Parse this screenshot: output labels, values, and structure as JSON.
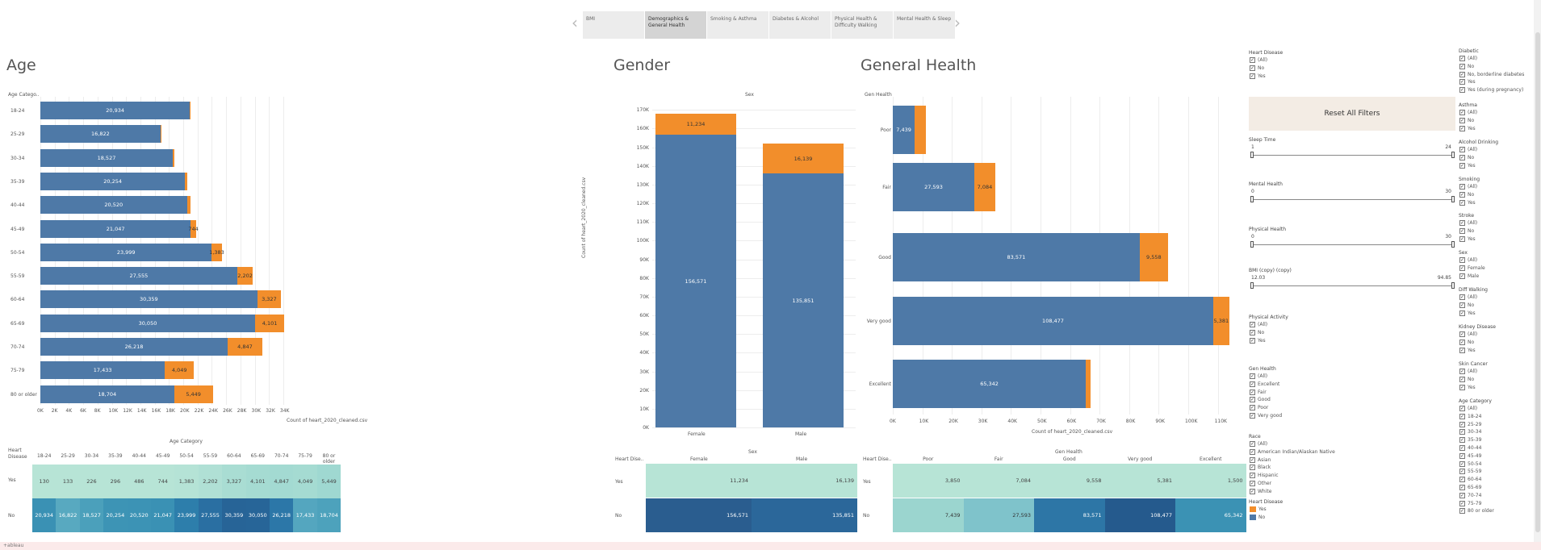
{
  "tabs": [
    "BMI",
    "Demographics & General Health",
    "Smoking & Asthma",
    "Diabetes & Alcohol",
    "Physical Health & Difficulty Walking",
    "Mental Health & Sleep"
  ],
  "active_tab": 1,
  "nav": {
    "prev": "‹",
    "next": "›"
  },
  "colors": {
    "no": "#4e79a7",
    "yes": "#f28e2b",
    "accent": "#f3ece4"
  },
  "age": {
    "title": "Age",
    "axis_title": "Age Catego..",
    "xlabel": "Count of heart_2020_cleaned.csv",
    "ticks": [
      "0K",
      "2K",
      "4K",
      "6K",
      "8K",
      "10K",
      "12K",
      "14K",
      "16K",
      "18K",
      "20K",
      "22K",
      "24K",
      "26K",
      "28K",
      "30K",
      "32K",
      "34K"
    ],
    "categories": [
      "18-24",
      "25-29",
      "30-34",
      "35-39",
      "40-44",
      "45-49",
      "50-54",
      "55-59",
      "60-64",
      "65-69",
      "70-74",
      "75-79",
      "80 or older"
    ],
    "no": [
      20934,
      16822,
      18527,
      20254,
      20520,
      21047,
      23999,
      27555,
      30359,
      30050,
      26218,
      17433,
      18704
    ],
    "yes": [
      130,
      133,
      226,
      296,
      486,
      744,
      1383,
      2202,
      3327,
      4101,
      4847,
      4049,
      5449
    ],
    "no_labels": [
      "20,934",
      "16,822",
      "18,527",
      "20,254",
      "20,520",
      "21,047",
      "23,999",
      "27,555",
      "30,359",
      "30,050",
      "26,218",
      "17,433",
      "18,704"
    ],
    "yes_labels": [
      "",
      "",
      "",
      "",
      "",
      "744",
      "1,383",
      "2,202",
      "3,327",
      "4,101",
      "4,847",
      "4,049",
      "5,449"
    ],
    "table_title": "Age Category",
    "table_row_header": "Heart Disease",
    "table_yes": [
      "130",
      "133",
      "226",
      "296",
      "486",
      "744",
      "1,383",
      "2,202",
      "3,327",
      "4,101",
      "4,847",
      "4,049",
      "5,449"
    ],
    "table_no": [
      "20,934",
      "16,822",
      "18,527",
      "20,254",
      "20,520",
      "21,047",
      "23,999",
      "27,555",
      "30,359",
      "30,050",
      "26,218",
      "17,433",
      "18,704"
    ]
  },
  "gender": {
    "title": "Gender",
    "header": "Sex",
    "ylabel": "Count of heart_2020_cleaned.csv",
    "ticks": [
      "0K",
      "10K",
      "20K",
      "30K",
      "40K",
      "50K",
      "60K",
      "70K",
      "80K",
      "90K",
      "100K",
      "110K",
      "120K",
      "130K",
      "140K",
      "150K",
      "160K",
      "170K"
    ],
    "categories": [
      "Female",
      "Male"
    ],
    "no": [
      156571,
      135851
    ],
    "yes": [
      11234,
      16139
    ],
    "no_labels": [
      "156,571",
      "135,851"
    ],
    "yes_labels": [
      "11,234",
      "16,139"
    ],
    "table_title": "Sex",
    "table_row_header": "Heart Dise..",
    "table_yes": [
      "11,234",
      "16,139"
    ],
    "table_no": [
      "156,571",
      "135,851"
    ]
  },
  "genhealth": {
    "title": "General Health",
    "axis_title": "Gen Health",
    "xlabel": "Count of heart_2020_cleaned.csv",
    "ticks": [
      "0K",
      "10K",
      "20K",
      "30K",
      "40K",
      "50K",
      "60K",
      "70K",
      "80K",
      "90K",
      "100K",
      "110K"
    ],
    "categories": [
      "Poor",
      "Fair",
      "Good",
      "Very good",
      "Excellent"
    ],
    "no": [
      7439,
      27593,
      83571,
      108477,
      65342
    ],
    "yes": [
      3850,
      7084,
      9558,
      5381,
      1500
    ],
    "no_labels": [
      "7,439",
      "27,593",
      "83,571",
      "108,477",
      "65,342"
    ],
    "yes_labels": [
      "",
      "7,084",
      "9,558",
      "5,381",
      ""
    ],
    "table_title": "Gen Health",
    "table_row_header": "Heart Dise..",
    "table_yes": [
      "3,850",
      "7,084",
      "9,558",
      "5,381",
      "1,500"
    ],
    "table_no": [
      "7,439",
      "27,593",
      "83,571",
      "108,477",
      "65,342"
    ]
  },
  "row_labels": [
    "Yes",
    "No"
  ],
  "filters": {
    "reset": "Reset All Filters",
    "heart_disease": {
      "title": "Heart Disease",
      "opts": [
        "(All)",
        "No",
        "Yes"
      ]
    },
    "sleep": {
      "title": "Sleep Time",
      "min": "1",
      "max": "24"
    },
    "mental": {
      "title": "Mental Health",
      "min": "0",
      "max": "30"
    },
    "physical": {
      "title": "Physical Health",
      "min": "0",
      "max": "30"
    },
    "bmi": {
      "title": "BMI (copy) (copy)",
      "min": "12.03",
      "max": "94.85"
    },
    "phys_activity": {
      "title": "Physical Activity",
      "opts": [
        "(All)",
        "No",
        "Yes"
      ]
    },
    "gen_health": {
      "title": "Gen Health",
      "opts": [
        "(All)",
        "Excellent",
        "Fair",
        "Good",
        "Poor",
        "Very good"
      ]
    },
    "race": {
      "title": "Race",
      "opts": [
        "(All)",
        "American Indian/Alaskan Native",
        "Asian",
        "Black",
        "Hispanic",
        "Other",
        "White"
      ]
    },
    "legend": {
      "title": "Heart Disease",
      "opts": [
        "Yes",
        "No"
      ]
    },
    "diabetic": {
      "title": "Diabetic",
      "opts": [
        "(All)",
        "No",
        "No, borderline diabetes",
        "Yes",
        "Yes (during pregnancy)"
      ]
    },
    "asthma": {
      "title": "Asthma",
      "opts": [
        "(All)",
        "No",
        "Yes"
      ]
    },
    "alcohol": {
      "title": "Alcohol Drinking",
      "opts": [
        "(All)",
        "No",
        "Yes"
      ]
    },
    "smoking": {
      "title": "Smoking",
      "opts": [
        "(All)",
        "No",
        "Yes"
      ]
    },
    "stroke": {
      "title": "Stroke",
      "opts": [
        "(All)",
        "No",
        "Yes"
      ]
    },
    "sex": {
      "title": "Sex",
      "opts": [
        "(All)",
        "Female",
        "Male"
      ]
    },
    "diffwalking": {
      "title": "Diff Walking",
      "opts": [
        "(All)",
        "No",
        "Yes"
      ]
    },
    "kidney": {
      "title": "Kidney Disease",
      "opts": [
        "(All)",
        "No",
        "Yes"
      ]
    },
    "skin": {
      "title": "Skin Cancer",
      "opts": [
        "(All)",
        "No",
        "Yes"
      ]
    },
    "agecat": {
      "title": "Age Category",
      "opts": [
        "(All)",
        "18-24",
        "25-29",
        "30-34",
        "35-39",
        "40-44",
        "45-49",
        "50-54",
        "55-59",
        "60-64",
        "65-69",
        "70-74",
        "75-79",
        "80 or older"
      ]
    }
  },
  "footer": "+ableau"
}
